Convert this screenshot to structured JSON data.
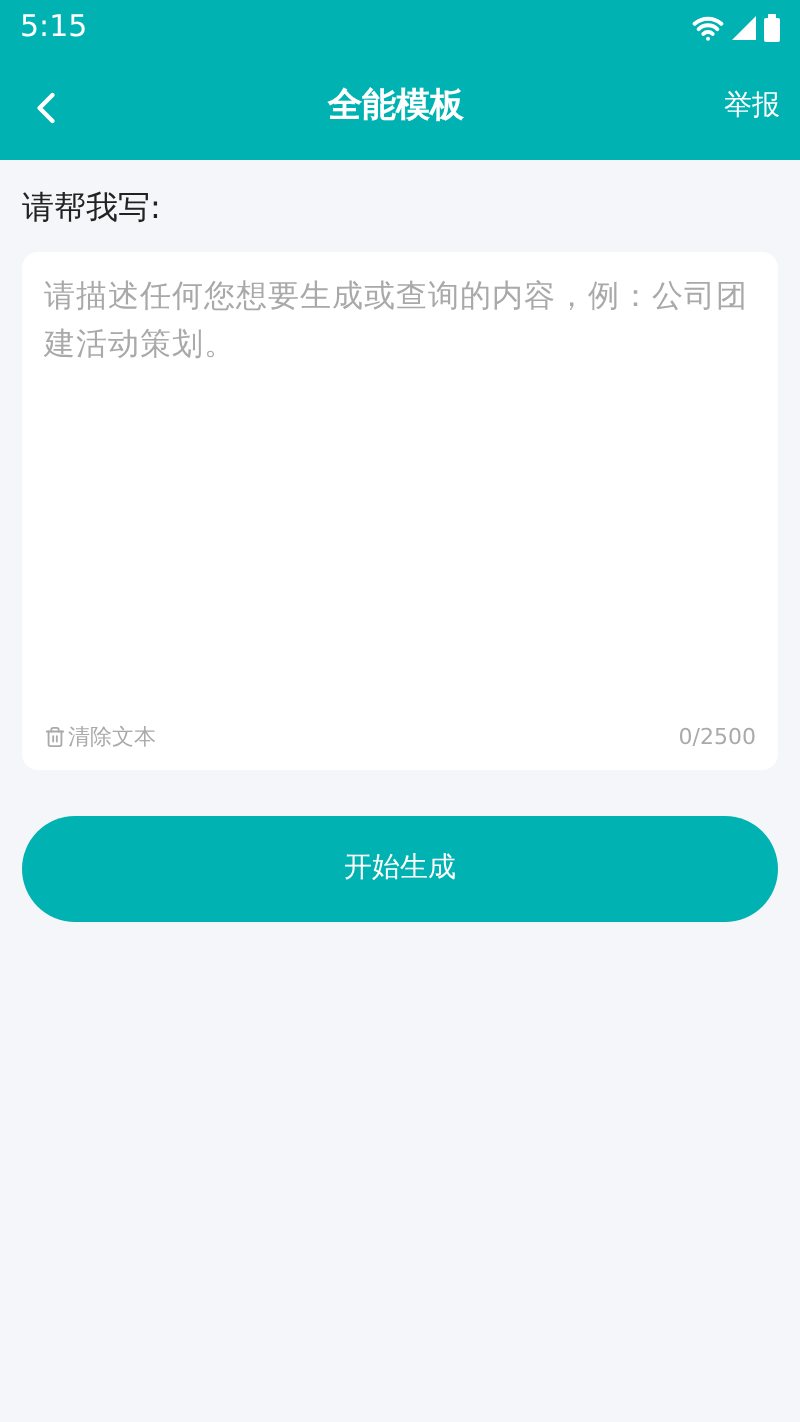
{
  "status_bar": {
    "time": "5:15"
  },
  "header": {
    "title": "全能模板",
    "action": "举报"
  },
  "prompt": {
    "label": "请帮我写:",
    "placeholder": "请描述任何您想要生成或查询的内容，例：公司团建活动策划。",
    "clear": "清除文本",
    "counter": "0/2500"
  },
  "submit": "开始生成"
}
